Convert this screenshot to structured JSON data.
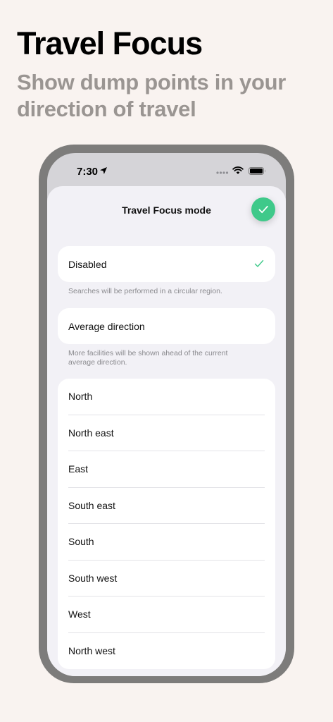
{
  "promo": {
    "title": "Travel Focus",
    "subtitle": "Show dump points in your direction of travel"
  },
  "status_bar": {
    "time": "7:30",
    "icons": [
      "location-arrow-icon",
      "signal-dots-icon",
      "wifi-icon",
      "battery-icon"
    ]
  },
  "sheet": {
    "title": "Travel Focus mode",
    "done_icon": "checkmark-icon",
    "accent_color": "#3fc98a"
  },
  "options": {
    "disabled": {
      "label": "Disabled",
      "selected": true,
      "footnote": "Searches will be performed in a circular region."
    },
    "average": {
      "label": "Average direction",
      "footnote": "More facilities will be shown ahead of the current average direction."
    }
  },
  "directions": [
    "North",
    "North east",
    "East",
    "South east",
    "South",
    "South west",
    "West",
    "North west"
  ]
}
